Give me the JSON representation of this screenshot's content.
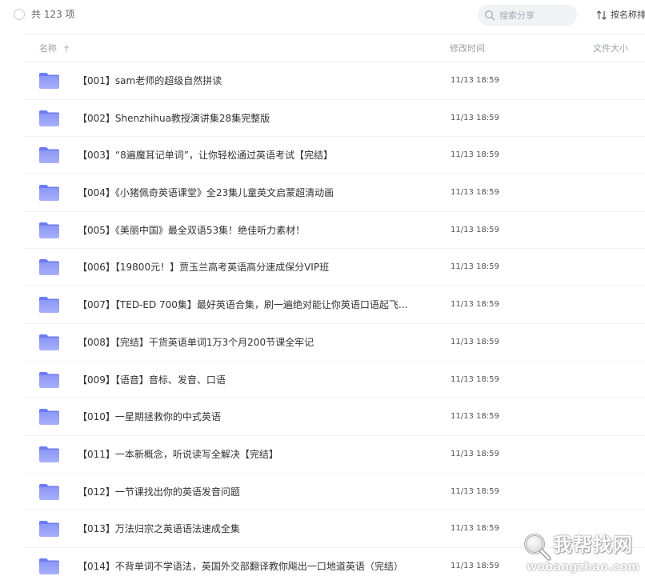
{
  "toolbar": {
    "count_label": "共 123 项",
    "search_placeholder": "搜索分享",
    "sort_label": "按名称排"
  },
  "header": {
    "name": "名称",
    "mtime": "修改时间",
    "size": "文件大小"
  },
  "rows": [
    {
      "name": "【001】sam老师的超级自然拼读",
      "time": "11/13 18:59"
    },
    {
      "name": "【002】Shenzhihua教授演讲集28集完整版",
      "time": "11/13 18:59"
    },
    {
      "name": "【003】“8遍魔耳记单词”，让你轻松通过英语考试【完结】",
      "time": "11/13 18:59"
    },
    {
      "name": "【004】《小猪佩奇英语课堂》全23集儿童英文启蒙超清动画",
      "time": "11/13 18:59"
    },
    {
      "name": "【005】《美丽中国》最全双语53集！绝佳听力素材！",
      "time": "11/13 18:59"
    },
    {
      "name": "【006】【19800元！】贾玉兰高考英语高分速成保分VIP班",
      "time": "11/13 18:59"
    },
    {
      "name": "【007】【TED-ED 700集】最好英语合集，刷一遍绝对能让你英语口语起飞...",
      "time": "11/13 18:59"
    },
    {
      "name": "【008】【完结】干货英语单词1万3个月200节课全牢记",
      "time": "11/13 18:59"
    },
    {
      "name": "【009】【语音】音标、发音、口语",
      "time": "11/13 18:59"
    },
    {
      "name": "【010】一星期拯救你的中式英语",
      "time": "11/13 18:59"
    },
    {
      "name": "【011】一本新概念，听说读写全解决【完结】",
      "time": "11/13 18:59"
    },
    {
      "name": "【012】一节课找出你的英语发音问题",
      "time": "11/13 18:59"
    },
    {
      "name": "【013】万法归宗之英语语法速成全集",
      "time": "11/13 18:59"
    },
    {
      "name": "【014】不背单词不学语法，英国外交部翻译教你飚出一口地道英语（完结）",
      "time": "11/13 18:59"
    }
  ],
  "watermark": {
    "cn": "我帮找网",
    "en": "wobangzhao.com"
  },
  "colors": {
    "folder": "#8b97f5",
    "folder_tab": "#6d7af0",
    "text": "#333333",
    "muted": "#9a9ea7"
  }
}
